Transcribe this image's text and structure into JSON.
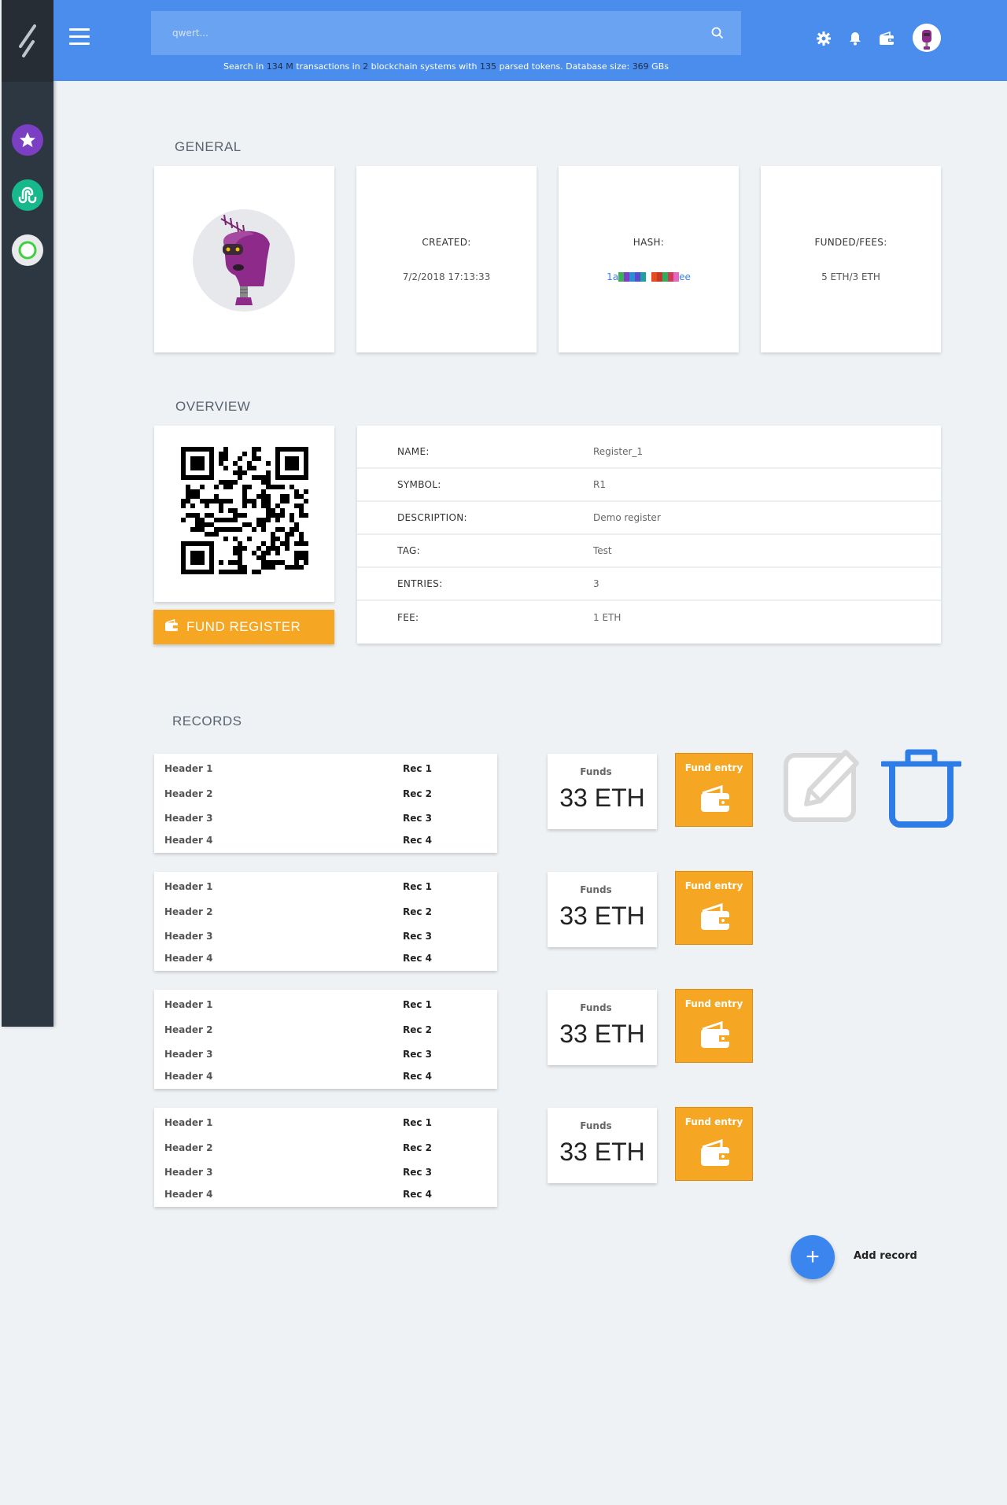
{
  "search": {
    "placeholder": "qwert...",
    "stats_prefix": "Search in ",
    "transactions_count": "134 M",
    "stats_mid1": " transactions in ",
    "chains_count": "2",
    "stats_mid2": " blockchain systems with ",
    "tokens_count": "135",
    "stats_mid3": " parsed tokens. Database size: ",
    "db_size": "369",
    "stats_suffix": " GBs"
  },
  "icons": {
    "brand": "logo-slash-icon",
    "menu": "hamburger-menu-icon",
    "search": "search-icon",
    "settings": "gear-icon",
    "notifications": "bell-icon",
    "wallet": "wallet-icon",
    "favorites": "star-icon",
    "stumble": "stumbleupon-icon",
    "status": "ring-icon"
  },
  "colors": {
    "topbar": "#4a8ded",
    "sidebar": "#2d3741",
    "accent_orange": "#f5a623",
    "accent_blue": "#3a86ee"
  },
  "general": {
    "title": "GENERAL",
    "created_label": "CREATED:",
    "created_value": "7/2/2018 17:13:33",
    "hash_label": "HASH:",
    "hash_start": "1a",
    "hash_end": "ee",
    "funded_label": "FUNDED/FEES:",
    "funded_value": "5 ETH/3 ETH"
  },
  "overview": {
    "title": "OVERVIEW",
    "fund_button": "FUND REGISTER",
    "rows": [
      {
        "key": "NAME:",
        "value": "Register_1"
      },
      {
        "key": "SYMBOL:",
        "value": "R1"
      },
      {
        "key": "DESCRIPTION:",
        "value": "Demo register"
      },
      {
        "key": "TAG:",
        "value": "Test"
      },
      {
        "key": "ENTRIES:",
        "value": "3"
      },
      {
        "key": "FEE:",
        "value": "1 ETH"
      }
    ]
  },
  "records": {
    "title": "RECORDS",
    "items": [
      {
        "rows": [
          {
            "h": "Header 1",
            "r": "Rec 1"
          },
          {
            "h": "Header 2",
            "r": "Rec 2"
          },
          {
            "h": "Header 3",
            "r": "Rec 3"
          },
          {
            "h": "Header 4",
            "r": "Rec 4"
          }
        ],
        "funds_label": "Funds",
        "funds_value": "33 ETH",
        "fund_entry": "Fund entry"
      },
      {
        "rows": [
          {
            "h": "Header 1",
            "r": "Rec 1"
          },
          {
            "h": "Header 2",
            "r": "Rec 2"
          },
          {
            "h": "Header 3",
            "r": "Rec 3"
          },
          {
            "h": "Header 4",
            "r": "Rec 4"
          }
        ],
        "funds_label": "Funds",
        "funds_value": "33 ETH",
        "fund_entry": "Fund entry"
      },
      {
        "rows": [
          {
            "h": "Header 1",
            "r": "Rec 1"
          },
          {
            "h": "Header 2",
            "r": "Rec 2"
          },
          {
            "h": "Header 3",
            "r": "Rec 3"
          },
          {
            "h": "Header 4",
            "r": "Rec 4"
          }
        ],
        "funds_label": "Funds",
        "funds_value": "33 ETH",
        "fund_entry": "Fund entry"
      },
      {
        "rows": [
          {
            "h": "Header 1",
            "r": "Rec 1"
          },
          {
            "h": "Header 2",
            "r": "Rec 2"
          },
          {
            "h": "Header 3",
            "r": "Rec 3"
          },
          {
            "h": "Header 4",
            "r": "Rec 4"
          }
        ],
        "funds_label": "Funds",
        "funds_value": "33 ETH",
        "fund_entry": "Fund entry"
      }
    ],
    "add_label": "Add record"
  }
}
